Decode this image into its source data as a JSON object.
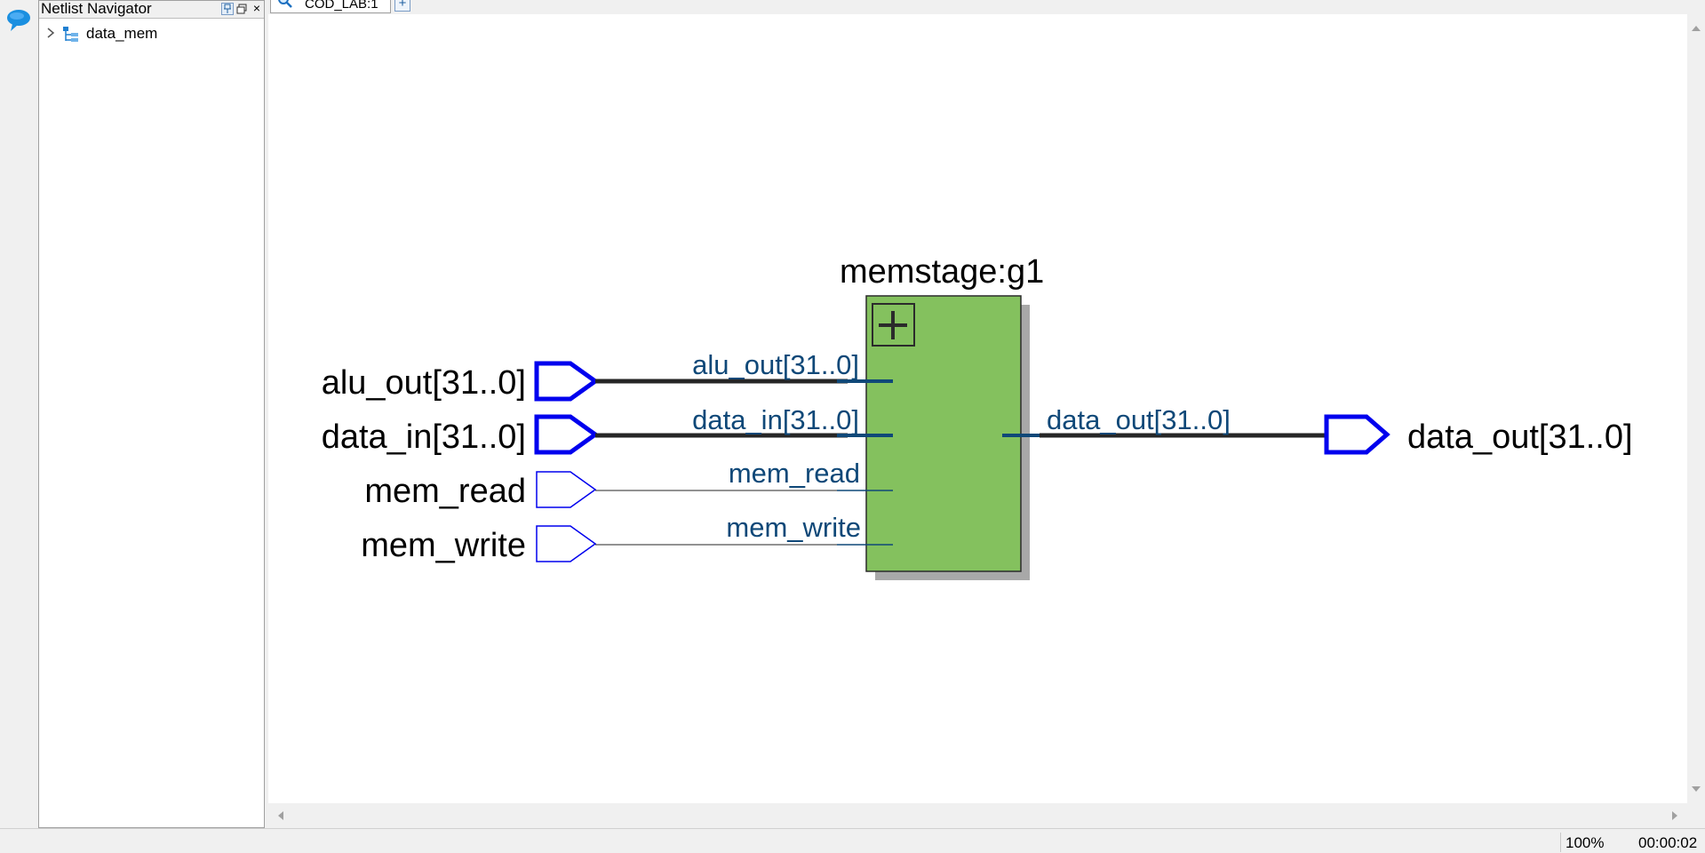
{
  "navigator": {
    "title": "Netlist Navigator",
    "tree": [
      {
        "label": "data_mem",
        "icon": "hierarchy-icon"
      }
    ]
  },
  "tabs": [
    {
      "label": "COD_LAB:1",
      "icon": "magnifier-icon"
    }
  ],
  "tab_add_label": "+",
  "schematic": {
    "instance_name": "memstage:g1",
    "expand_button": "+",
    "inputs": [
      {
        "pin_label": "alu_out[31..0]",
        "port_label": "alu_out[31..0]",
        "bus": true
      },
      {
        "pin_label": "data_in[31..0]",
        "port_label": "data_in[31..0]",
        "bus": true
      },
      {
        "pin_label": "mem_read",
        "port_label": "mem_read",
        "bus": false
      },
      {
        "pin_label": "mem_write",
        "port_label": "mem_write",
        "bus": false
      }
    ],
    "outputs": [
      {
        "pin_label": "data_out[31..0]",
        "port_label": "data_out[31..0]",
        "bus": true
      }
    ],
    "colors": {
      "block_fill": "#84c15e",
      "pin_stroke": "#0000ee",
      "port_text": "#0f4878",
      "wire": "#262626"
    }
  },
  "status": {
    "zoom": "100%",
    "time": "00:00:02"
  }
}
